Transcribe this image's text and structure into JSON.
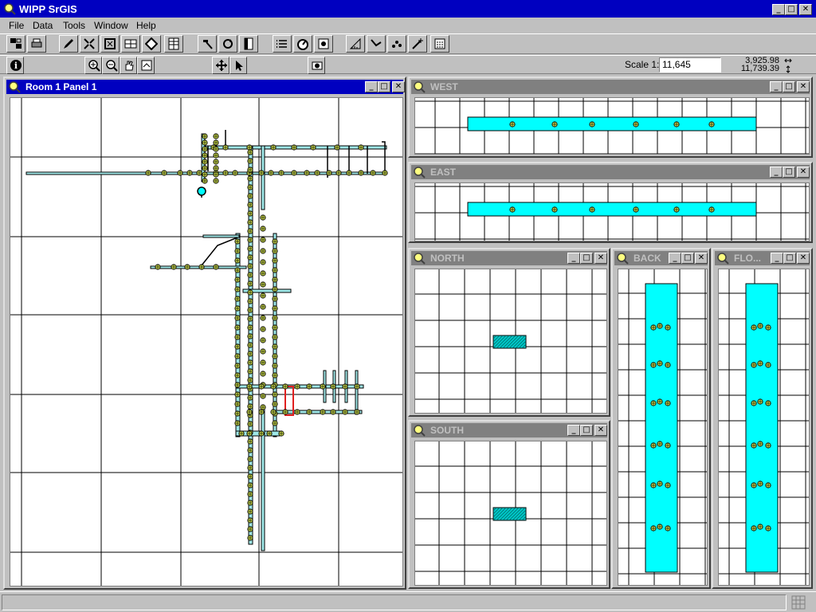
{
  "app": {
    "title": "WIPP SrGIS"
  },
  "menu": [
    {
      "label": "File"
    },
    {
      "label": "Data"
    },
    {
      "label": "Tools"
    },
    {
      "label": "Window"
    },
    {
      "label": "Help"
    }
  ],
  "statusbar": {
    "scale_label": "Scale 1:",
    "scale_value": "11,645",
    "coord_x": "3,925.98",
    "coord_y": "11,739.39"
  },
  "windows": {
    "main": {
      "title": "Room 1 Panel 1"
    },
    "west": {
      "title": "WEST"
    },
    "east": {
      "title": "EAST"
    },
    "north": {
      "title": "NORTH"
    },
    "south": {
      "title": "SOUTH"
    },
    "back": {
      "title": "BACK"
    },
    "floor": {
      "title": "FLO..."
    }
  },
  "colors": {
    "titlebar_active": "#0000c0",
    "titlebar_inactive": "#808080",
    "panel_fill": "#00ffff",
    "marker_fill": "#c8d84a",
    "selection": "#e02020"
  },
  "icons": [
    "app-icon",
    "minimize-icon",
    "maximize-icon",
    "close-icon",
    "info-icon",
    "zoom-in-icon",
    "zoom-out-icon",
    "pan-hand-icon",
    "pointer-icon",
    "map-tile-icon"
  ]
}
